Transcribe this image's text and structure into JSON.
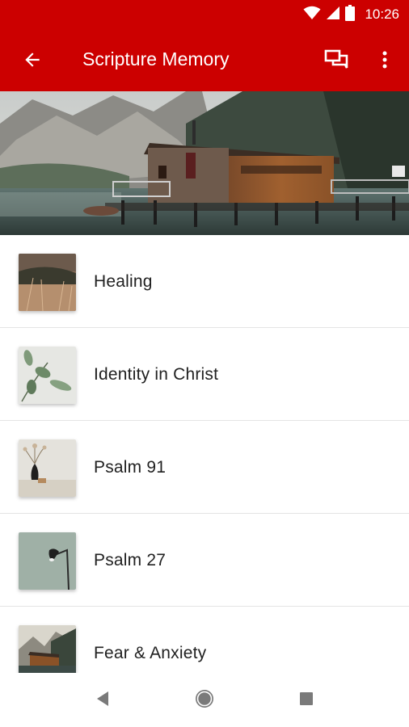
{
  "status_bar": {
    "time": "10:26",
    "icons": [
      "wifi-icon",
      "cellular-signal-icon",
      "battery-icon"
    ]
  },
  "app_bar": {
    "title": "Scripture Memory",
    "icons": [
      "back-arrow-icon",
      "chat-bubbles-icon",
      "more-vert-icon"
    ]
  },
  "hero": {
    "image": "lake-boathouse-mountains-photo"
  },
  "list": {
    "items": [
      {
        "label": "Healing",
        "thumb": "dry-grass-photo"
      },
      {
        "label": "Identity in Christ",
        "thumb": "eucalyptus-leaves-photo"
      },
      {
        "label": "Psalm 91",
        "thumb": "vase-dried-flower-photo"
      },
      {
        "label": "Psalm 27",
        "thumb": "desk-lamp-photo"
      },
      {
        "label": "Fear & Anxiety",
        "thumb": "boathouse-photo"
      }
    ]
  },
  "nav_bar": {
    "icons": [
      "back-triangle-icon",
      "home-circle-icon",
      "recents-square-icon"
    ]
  },
  "colors": {
    "primary": "#cc0000",
    "text": "#212121",
    "divider": "#e4e4e4"
  }
}
